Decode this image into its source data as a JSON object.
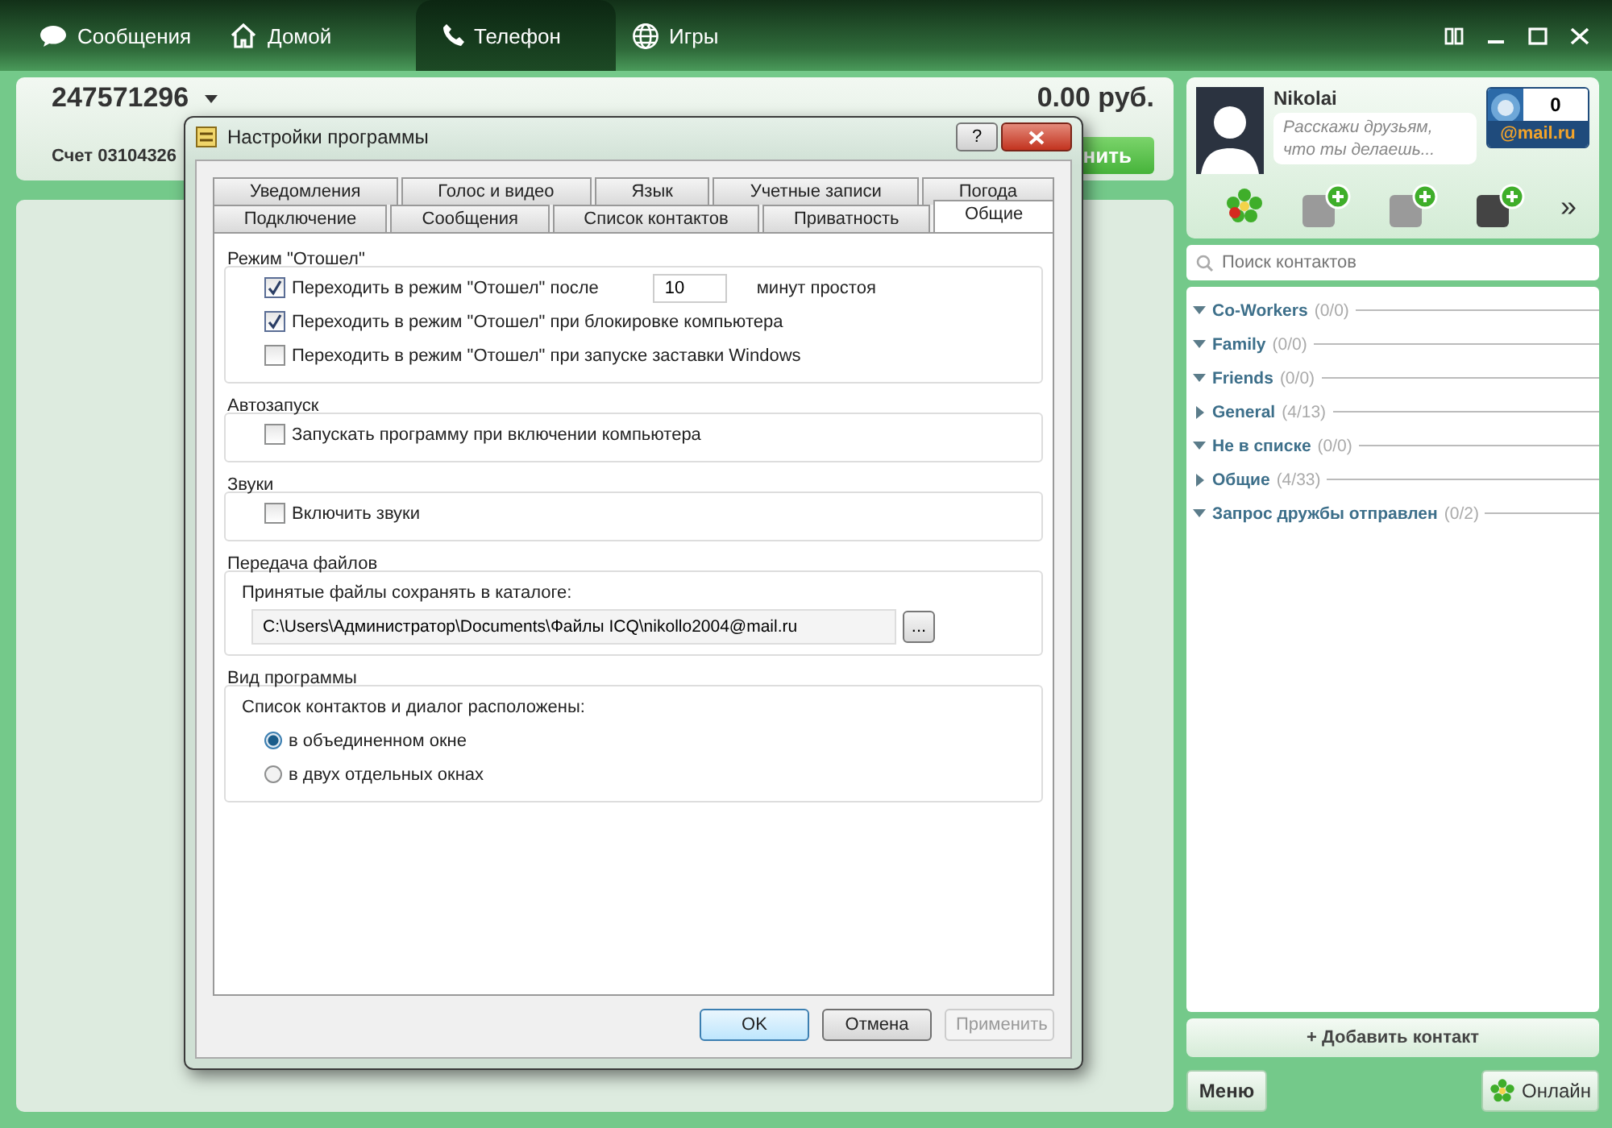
{
  "nav_tabs": [
    {
      "label": "Сообщения",
      "selected": false
    },
    {
      "label": "Домой",
      "selected": false
    },
    {
      "label": "Телефон",
      "selected": true
    },
    {
      "label": "Игры",
      "selected": false
    }
  ],
  "account": {
    "number": "247571296",
    "balance": "0.00 руб.",
    "account_label": "Счет 03104326",
    "action_button": "нить"
  },
  "profile": {
    "name": "Nikolai",
    "status_placeholder": "Расскажи друзьям, что ты делаешь...",
    "mail_count": "0",
    "mail_brand": "@mail.ru",
    "more": "»"
  },
  "search": {
    "placeholder": "Поиск контактов"
  },
  "groups": [
    {
      "name": "Co-Workers",
      "count": "(0/0)",
      "expanded": true
    },
    {
      "name": "Family",
      "count": "(0/0)",
      "expanded": true
    },
    {
      "name": "Friends",
      "count": "(0/0)",
      "expanded": true
    },
    {
      "name": "General",
      "count": "(4/13)",
      "expanded": false
    },
    {
      "name": "Не в списке",
      "count": "(0/0)",
      "expanded": true
    },
    {
      "name": "Общие",
      "count": "(4/33)",
      "expanded": false
    },
    {
      "name": "Запрос дружбы отправлен",
      "count": "(0/2)",
      "expanded": true
    }
  ],
  "add_contact": "+ Добавить контакт",
  "menu_button": "Меню",
  "status_button": "Онлайн",
  "dialog": {
    "title": "Настройки программы",
    "help": "?",
    "tab_rows": [
      {
        "tabs": [
          {
            "label": "Уведомления",
            "selected": false
          },
          {
            "label": "Голос и видео",
            "selected": false
          },
          {
            "label": "Язык",
            "selected": false
          },
          {
            "label": "Учетные записи",
            "selected": false
          },
          {
            "label": "Погода",
            "selected": false
          }
        ]
      },
      {
        "tabs": [
          {
            "label": "Подключение",
            "selected": false
          },
          {
            "label": "Сообщения",
            "selected": false
          },
          {
            "label": "Список контактов",
            "selected": false
          },
          {
            "label": "Приватность",
            "selected": false
          },
          {
            "label": "Общие",
            "selected": true
          }
        ]
      }
    ],
    "sections": [
      {
        "title": "Режим \"Отошел\"",
        "items": [
          {
            "kind": "checkbox_number",
            "label": "Переходить в режим \"Отошел\" после",
            "checked": true,
            "value": "10",
            "suffix": "минут простоя"
          },
          {
            "kind": "checkbox",
            "label": "Переходить в режим \"Отошел\" при блокировке компьютера",
            "checked": true
          },
          {
            "kind": "checkbox",
            "label": "Переходить в режим \"Отошел\" при запуске заставки Windows",
            "checked": false
          }
        ]
      },
      {
        "title": "Автозапуск",
        "items": [
          {
            "kind": "checkbox",
            "label": "Запускать программу при включении компьютера",
            "checked": false
          }
        ]
      },
      {
        "title": "Звуки",
        "items": [
          {
            "kind": "checkbox",
            "label": "Включить звуки",
            "checked": false
          }
        ]
      },
      {
        "title": "Передача файлов",
        "items": [
          {
            "kind": "label",
            "label": "Принятые файлы сохранять в каталоге:"
          },
          {
            "kind": "path",
            "value": "C:\\Users\\Администратор\\Documents\\Файлы ICQ\\nikollo2004@mail.ru",
            "button": "..."
          }
        ]
      },
      {
        "title": "Вид программы",
        "items": [
          {
            "kind": "label",
            "label": "Список контактов и диалог расположены:"
          },
          {
            "kind": "radio",
            "label": "в объединенном окне",
            "selected": true
          },
          {
            "kind": "radio",
            "label": "в двух отдельных окнах",
            "selected": false
          }
        ]
      }
    ],
    "buttons": [
      {
        "label": "OK",
        "default": true,
        "disabled": false
      },
      {
        "label": "Отмена",
        "default": false,
        "disabled": false
      },
      {
        "label": "Применить",
        "default": false,
        "disabled": true
      }
    ]
  }
}
